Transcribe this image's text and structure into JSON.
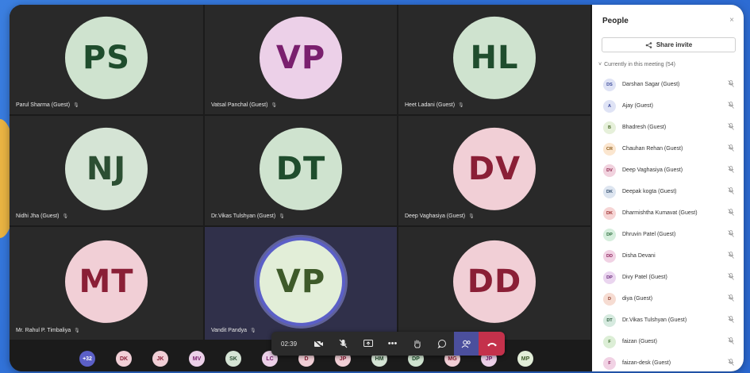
{
  "colors": {
    "accent": "#5b5fc7",
    "leave": "#c4314b",
    "panel_bg": "#ffffff",
    "stage_bg": "#1b1b1b"
  },
  "tiles": [
    {
      "initials": "PS",
      "name": "Parul Sharma (Guest)",
      "tone": "av-green"
    },
    {
      "initials": "VP",
      "name": "Vatsal Panchal (Guest)",
      "tone": "av-pink"
    },
    {
      "initials": "HL",
      "name": "Heet Ladani (Guest)",
      "tone": "av-green"
    },
    {
      "initials": "NJ",
      "name": "Nidhi Jha (Guest)",
      "tone": "av-sage"
    },
    {
      "initials": "DT",
      "name": "Dr.Vikas Tulshyan (Guest)",
      "tone": "av-green"
    },
    {
      "initials": "DV",
      "name": "Deep Vaghasiya (Guest)",
      "tone": "av-pink2"
    },
    {
      "initials": "MT",
      "name": "Mr. Rahul P. Timbaliya",
      "tone": "av-pink2"
    },
    {
      "initials": "VP",
      "name": "Vandit Pandya",
      "tone": "av-lime"
    },
    {
      "initials": "DD",
      "name": "",
      "tone": "av-pink2"
    }
  ],
  "bottom_chips": [
    {
      "label": "+32",
      "tone": "more"
    },
    {
      "label": "DK",
      "tone": "av-pink2"
    },
    {
      "label": "JK",
      "tone": "av-pink2"
    },
    {
      "label": "MV",
      "tone": "av-pink"
    },
    {
      "label": "SK",
      "tone": "av-sage"
    },
    {
      "label": "LC",
      "tone": "av-pink"
    },
    {
      "label": "D",
      "tone": "av-pink2"
    },
    {
      "label": "JP",
      "tone": "av-pink2"
    },
    {
      "label": "HM",
      "tone": "av-sage"
    },
    {
      "label": "DP",
      "tone": "av-green"
    },
    {
      "label": "MG",
      "tone": "av-pink2"
    },
    {
      "label": "JP",
      "tone": "av-pink"
    },
    {
      "label": "MP",
      "tone": "av-lime"
    }
  ],
  "controls": {
    "timer": "02:39",
    "icons": [
      "camera-off-icon",
      "mic-off-icon",
      "share-screen-icon",
      "more-icon",
      "raise-hand-icon",
      "chat-icon",
      "people-icon",
      "leave-call-icon"
    ]
  },
  "panel": {
    "title": "People",
    "close_glyph": "×",
    "share_label": "Share invite",
    "section_label": "Currently in this meeting (54)",
    "participants": [
      {
        "initials": "DS",
        "name": "Darshan Sagar (Guest)",
        "bg": "#dfe3f5",
        "fg": "#3b4a9a"
      },
      {
        "initials": "A",
        "name": "Ajay (Guest)",
        "bg": "#dfe3f5",
        "fg": "#3b4a9a"
      },
      {
        "initials": "B",
        "name": "Bhadresh (Guest)",
        "bg": "#e6f0da",
        "fg": "#4a6a2a"
      },
      {
        "initials": "CR",
        "name": "Chauhan Rehan (Guest)",
        "bg": "#fbe6cf",
        "fg": "#8a5a1a"
      },
      {
        "initials": "DV",
        "name": "Deep Vaghasiya (Guest)",
        "bg": "#f1d2de",
        "fg": "#8a1f46"
      },
      {
        "initials": "DK",
        "name": "Deepak kogta (Guest)",
        "bg": "#dde5f0",
        "fg": "#2f4a6a"
      },
      {
        "initials": "DK",
        "name": "Dharmishtha Kumavat (Guest)",
        "bg": "#f6d5d5",
        "fg": "#9a2a2a"
      },
      {
        "initials": "DP",
        "name": "Dhruvin Patel (Guest)",
        "bg": "#d6eedd",
        "fg": "#2a6a3a"
      },
      {
        "initials": "DD",
        "name": "Disha Devani",
        "bg": "#f1d2e4",
        "fg": "#8a1f5a"
      },
      {
        "initials": "DP",
        "name": "Divy Patel (Guest)",
        "bg": "#ead5ef",
        "fg": "#6a2a7a"
      },
      {
        "initials": "D",
        "name": "diya (Guest)",
        "bg": "#f6dcd2",
        "fg": "#8a3a2a"
      },
      {
        "initials": "DT",
        "name": "Dr.Vikas Tulshyan (Guest)",
        "bg": "#d6eadf",
        "fg": "#2a5a3a"
      },
      {
        "initials": "F",
        "name": "faizan (Guest)",
        "bg": "#dceed6",
        "fg": "#3a6a2a"
      },
      {
        "initials": "F",
        "name": "faizan-desk (Guest)",
        "bg": "#f1d2e4",
        "fg": "#8a1f5a"
      }
    ]
  }
}
